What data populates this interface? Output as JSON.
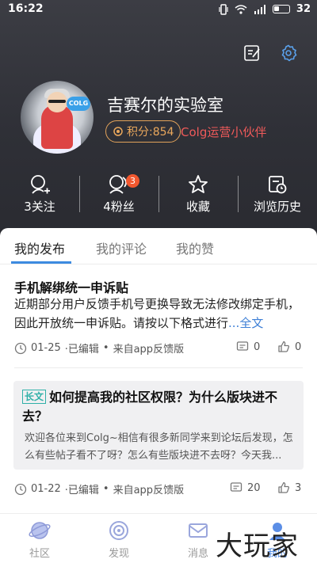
{
  "status_bar": {
    "time": "16:22",
    "battery": "32"
  },
  "header": {
    "edit_icon": "edit-icon",
    "settings_icon": "settings-gear-icon"
  },
  "profile": {
    "name": "吉赛尔的实验室",
    "points_label": "积分:854",
    "role": "Colg运营小伙伴",
    "avatar_badge_text": "COLG"
  },
  "stats": [
    {
      "label": "3关注",
      "icon": "user-add-icon"
    },
    {
      "label": "4粉丝",
      "icon": "fans-icon",
      "badge": "3"
    },
    {
      "label": "收藏",
      "icon": "star-icon"
    },
    {
      "label": "浏览历史",
      "icon": "history-icon"
    }
  ],
  "tabs": [
    {
      "label": "我的发布",
      "active": true
    },
    {
      "label": "我的评论",
      "active": false
    },
    {
      "label": "我的赞",
      "active": false
    }
  ],
  "posts": [
    {
      "title": "手机解绑统一申诉贴",
      "body": " 近期部分用户反馈手机号更换导致无法修改绑定手机，因此开放统一申诉贴。请按以下格式进行",
      "more": "...全文",
      "date": "01-25",
      "edited": "·已编辑",
      "source": "来自app反馈版",
      "comments": "0",
      "likes": "0"
    },
    {
      "tag": "长文",
      "title": "如何提高我的社区权限？为什么版块进不去？",
      "body": "欢迎各位来到Colg~相信有很多新同学来到论坛后发现，怎么有些帖子看不了呀？怎么有些版块进不去呀？今天我...",
      "date": "01-22",
      "edited": "·已编辑",
      "source": "来自app反馈版",
      "comments": "20",
      "likes": "3"
    }
  ],
  "bottom_nav": [
    {
      "label": "社区",
      "icon": "planet-icon"
    },
    {
      "label": "发现",
      "icon": "discover-icon"
    },
    {
      "label": "消息",
      "icon": "mail-icon"
    },
    {
      "label": "我的",
      "icon": "user-icon"
    }
  ],
  "watermark": "大玩家",
  "colors": {
    "accent": "#3d8be0",
    "points": "#eaa85c",
    "role": "#f05a5a",
    "badge": "#f2582f",
    "tag": "#2fb0a8"
  }
}
